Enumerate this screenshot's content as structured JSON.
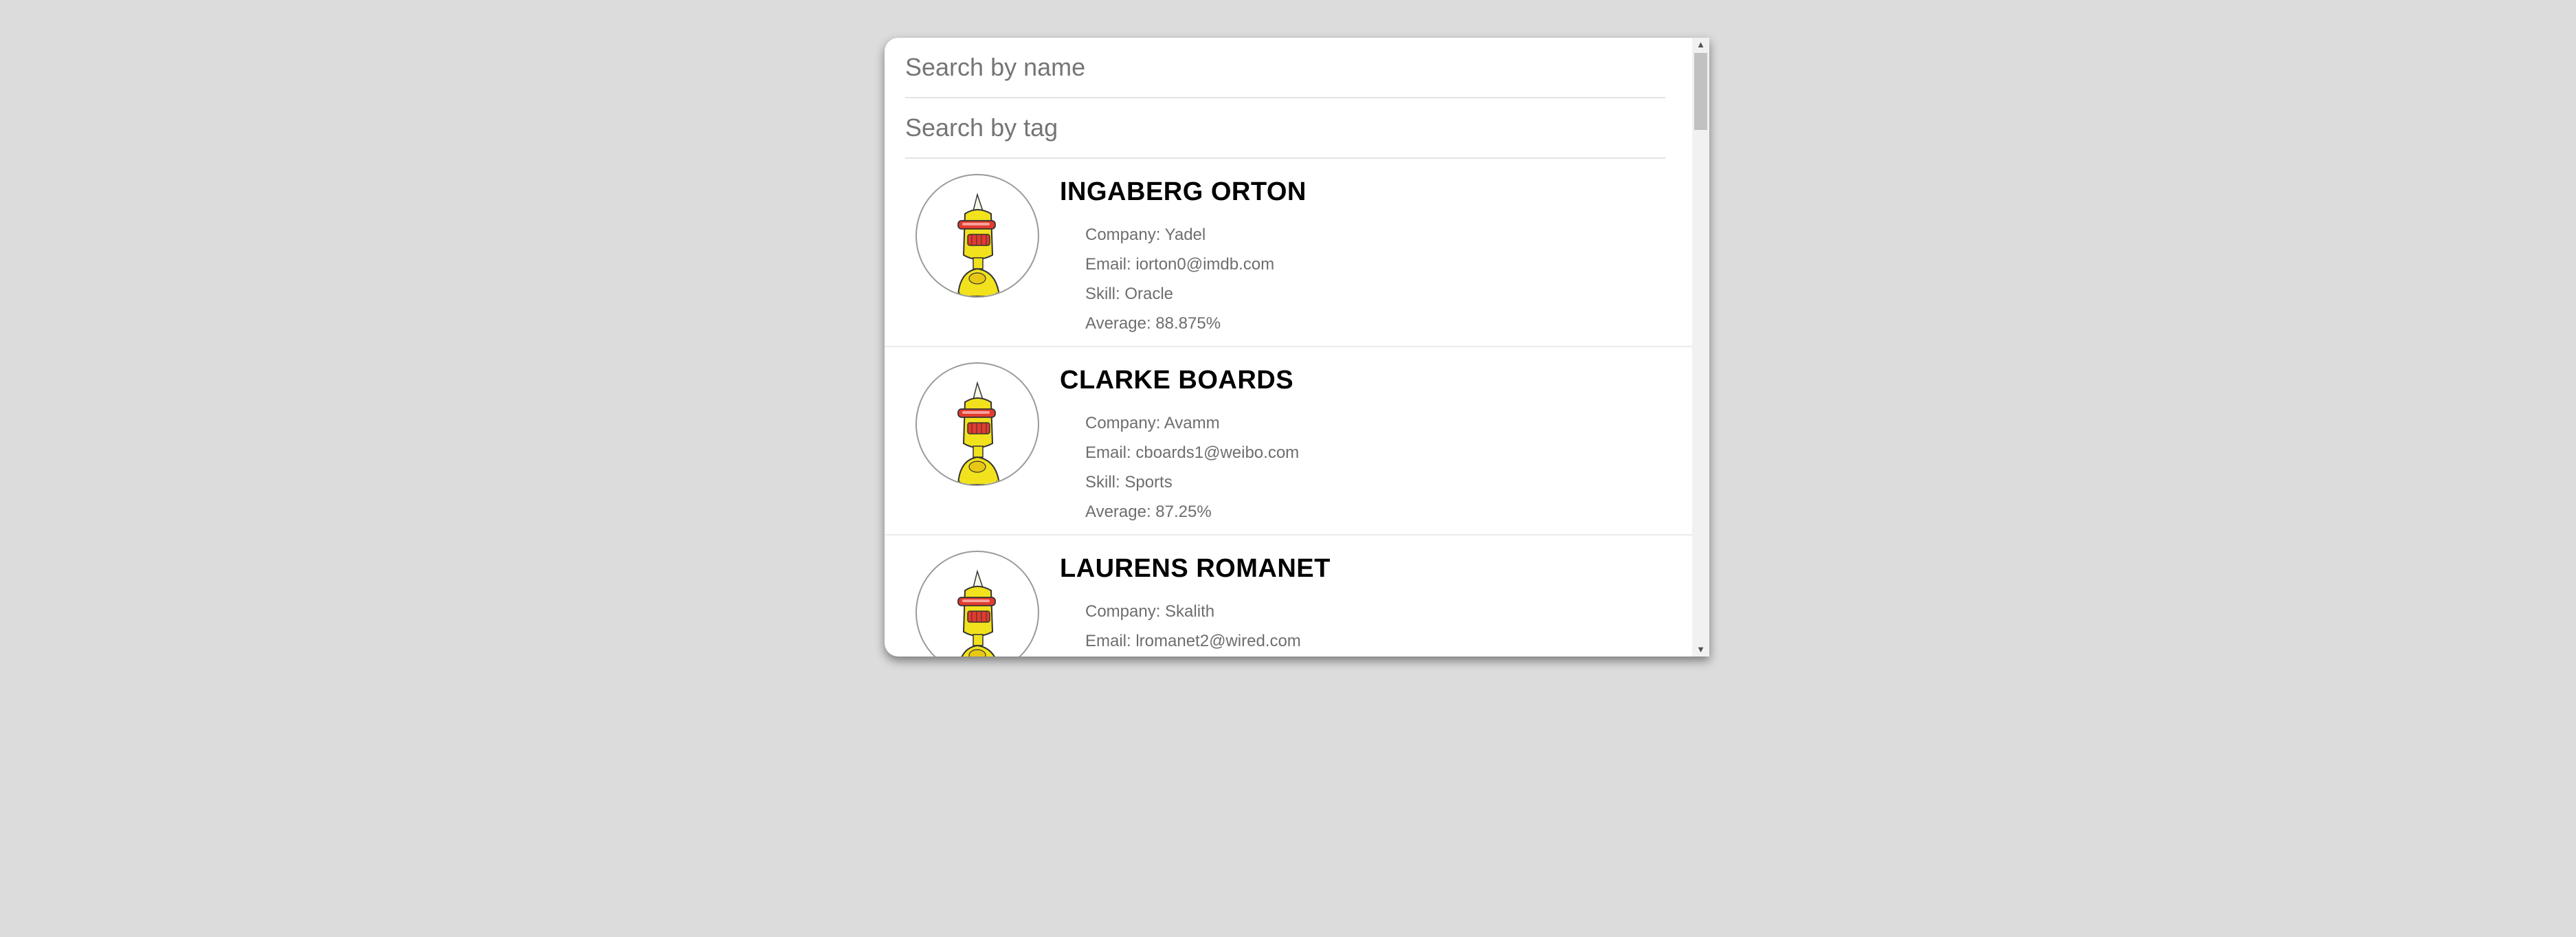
{
  "search": {
    "name_placeholder": "Search by name",
    "name_value": "",
    "tag_placeholder": "Search by tag",
    "tag_value": ""
  },
  "students": [
    {
      "name": "INGABERG ORTON",
      "company": "Company: Yadel",
      "email": "Email: iorton0@imdb.com",
      "skill": "Skill: Oracle",
      "average": "Average: 88.875%",
      "avatar_icon": "robot-avatar-icon"
    },
    {
      "name": "CLARKE BOARDS",
      "company": "Company: Avamm",
      "email": "Email: cboards1@weibo.com",
      "skill": "Skill: Sports",
      "average": "Average: 87.25%",
      "avatar_icon": "robot-avatar-icon"
    },
    {
      "name": "LAURENS ROMANET",
      "company": "Company: Skalith",
      "email": "Email: lromanet2@wired.com",
      "skill": "",
      "average": "",
      "avatar_icon": "robot-avatar-icon"
    }
  ],
  "colors": {
    "background": "#dcdcdc",
    "card": "#ffffff",
    "name_text": "#000000",
    "info_text": "#6e6e6e",
    "robot_yellow": "#f2e21d",
    "robot_visor": "#e23b2e"
  },
  "scrollbar": {
    "up_icon": "arrow-up-icon",
    "down_icon": "arrow-down-icon"
  }
}
